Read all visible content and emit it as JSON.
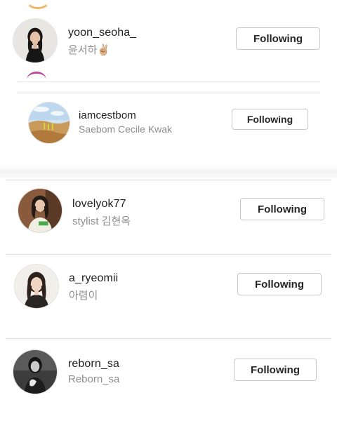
{
  "follow_list": [
    {
      "username": "yoon_seoha_",
      "full_name": "윤서하✌🏼",
      "button_label": "Following",
      "avatar": "avatar-woman-black-top"
    },
    {
      "username": "iamcestbom",
      "full_name": "Saebom Cecile Kwak",
      "button_label": "Following",
      "avatar": "avatar-desert-landscape"
    },
    {
      "username": "lovelyok77",
      "full_name": "stylist 김현옥",
      "button_label": "Following",
      "avatar": "avatar-woman-green-shirt"
    },
    {
      "username": "a_ryeomii",
      "full_name": "아렴이",
      "button_label": "Following",
      "avatar": "avatar-woman-selfie"
    },
    {
      "username": "reborn_sa",
      "full_name": "Reborn_sa",
      "button_label": "Following",
      "avatar": "avatar-woman-monochrome"
    }
  ],
  "colors": {
    "username": "#222222",
    "full_name": "#8e8e8e",
    "button_border": "#c9c9c9",
    "divider": "#dcdcdc"
  }
}
